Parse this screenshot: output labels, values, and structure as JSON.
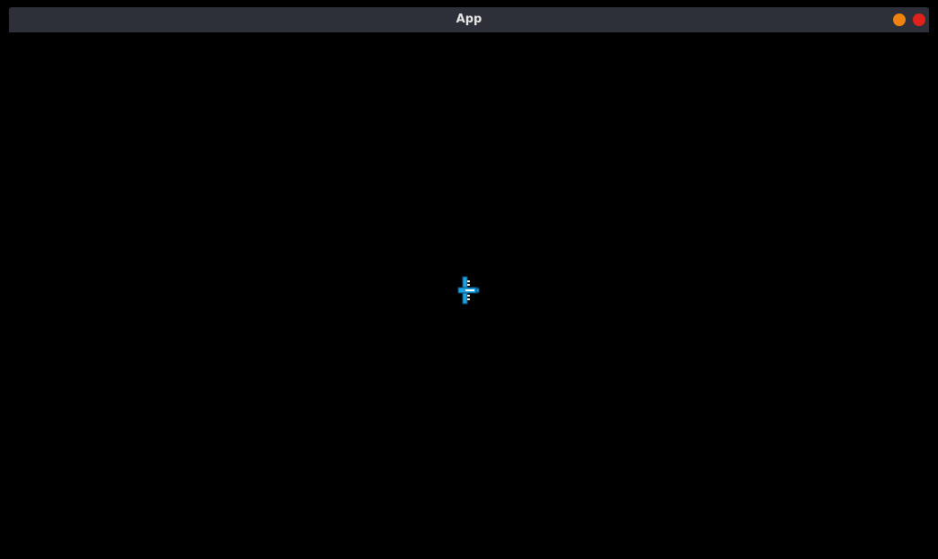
{
  "window": {
    "title": "App",
    "controls": [
      {
        "name": "minimize",
        "color": "#f0820f"
      },
      {
        "name": "close",
        "color": "#e0221c"
      }
    ]
  },
  "game": {
    "background": "#000000",
    "player": {
      "icon": "player-ship-icon",
      "colors": {
        "body": "#1ca3e6",
        "outline": "#0a4f7a",
        "light": "#ffffff"
      }
    }
  }
}
